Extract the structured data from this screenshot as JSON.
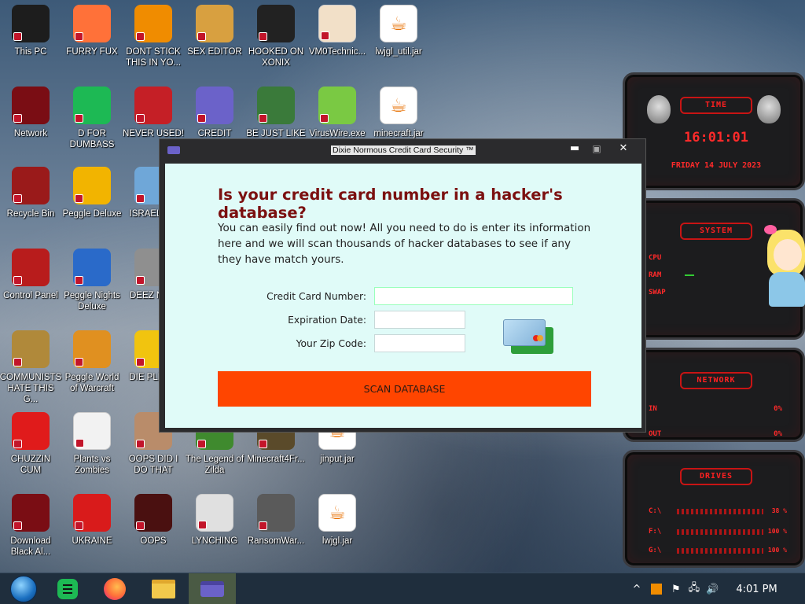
{
  "desktop": {
    "icons": [
      {
        "label": "This PC",
        "icon": "computer-icon",
        "color": "#1d1d1d"
      },
      {
        "label": "FURRY FUX",
        "icon": "firefox-icon",
        "color": "#ff7139"
      },
      {
        "label": "DONT STICK THIS IN YO...",
        "icon": "vlc-cone-icon",
        "color": "#f08c00"
      },
      {
        "label": "SEX EDITOR",
        "icon": "hxd-editor-icon",
        "color": "#d8a040"
      },
      {
        "label": "HOOKED ON XONIX",
        "icon": "xonix-game-icon",
        "color": "#222222"
      },
      {
        "label": "VM0Technic...",
        "icon": "doctor-icon",
        "color": "#f2e0c8"
      },
      {
        "label": "lwjgl_util.jar",
        "icon": "java-icon",
        "color": "#ffffff"
      },
      {
        "label": "Network",
        "icon": "network-alien-icon",
        "color": "#7a0d14"
      },
      {
        "label": "D FOR DUMBASS",
        "icon": "chat-icon",
        "color": "#1db954"
      },
      {
        "label": "NEVER USED!",
        "icon": "devcpp-icon",
        "color": "#c51f26"
      },
      {
        "label": "CREDIT CARD CHECKER",
        "icon": "credit-card-icon",
        "color": "#6b62c9"
      },
      {
        "label": "BE JUST LIKE THE DUDE!",
        "icon": "elf-icon",
        "color": "#3a7a3a"
      },
      {
        "label": "VirusWire.exe",
        "icon": "lime-icon",
        "color": "#7ac943"
      },
      {
        "label": "minecraft.jar",
        "icon": "java-icon",
        "color": "#ffffff"
      },
      {
        "label": "Recycle Bin",
        "icon": "recycle-bin-icon",
        "color": "#9a1a1a"
      },
      {
        "label": "Peggle Deluxe",
        "icon": "peggle-icon",
        "color": "#f2b400"
      },
      {
        "label": "ISRAEL S...",
        "icon": "tool-icon",
        "color": "#6fa7d8"
      },
      {
        "label": "Control Panel",
        "icon": "control-panel-icon",
        "color": "#b81c1c"
      },
      {
        "label": "Peggle Nights Deluxe",
        "icon": "peggle-icon",
        "color": "#2a6ac9"
      },
      {
        "label": "DEEZ NU...",
        "icon": "stack-icon",
        "color": "#8f8f8f"
      },
      {
        "label": "COMMUNISTS HATE THIS G...",
        "icon": "money-bag-icon",
        "color": "#b0893a"
      },
      {
        "label": "Peggle World of Warcraft",
        "icon": "peggle-icon",
        "color": "#e09020"
      },
      {
        "label": "DIE PLEA...",
        "icon": "d-logo-icon",
        "color": "#f1c40f"
      },
      {
        "label": "CHUZZIN CUM",
        "icon": "chuzzle-icon",
        "color": "#e01b1b"
      },
      {
        "label": "Plants vs Zombies",
        "icon": "flower-icon",
        "color": "#f2f2f2"
      },
      {
        "label": "OOPS DID I DO THAT",
        "icon": "portrait-icon",
        "color": "#b98c6a"
      },
      {
        "label": "The Legend of Zilda",
        "icon": "zelda-icon",
        "color": "#3f8a2e"
      },
      {
        "label": "Minecraft4Fr...",
        "icon": "minecraft-icon",
        "color": "#5a4a2a"
      },
      {
        "label": "jinput.jar",
        "icon": "java-icon",
        "color": "#ffffff"
      },
      {
        "label": "Download Black Al...",
        "icon": "alien-icon",
        "color": "#7a0d14"
      },
      {
        "label": "UKRAINE",
        "icon": "radiation-icon",
        "color": "#d91b1b"
      },
      {
        "label": "OOPS",
        "icon": "app-icon",
        "color": "#4a1010"
      },
      {
        "label": "LYNCHING",
        "icon": "rope-icon",
        "color": "#e0e0e0"
      },
      {
        "label": "RansomWar...",
        "icon": "skull-icon",
        "color": "#5a5a5a"
      },
      {
        "label": "lwjgl.jar",
        "icon": "java-icon",
        "color": "#ffffff"
      }
    ]
  },
  "widget": {
    "time_title": "TIME",
    "time": "16:01:01",
    "date": "FRIDAY 14 JULY 2023",
    "system_title": "SYSTEM",
    "cpu_label": "CPU",
    "ram_label": "RAM",
    "swap_label": "SWAP",
    "network_title": "NETWORK",
    "in_label": "IN",
    "out_label": "OUT",
    "in_value": "0%",
    "out_value": "0%",
    "drives_title": "DRIVES",
    "drives": [
      {
        "label": "C:\\",
        "value": "38 %"
      },
      {
        "label": "F:\\",
        "value": "100 %"
      },
      {
        "label": "G:\\",
        "value": "100 %"
      }
    ]
  },
  "window": {
    "title": "Dixie Normous Credit Card Security ™",
    "minimize": "▬",
    "maximize": "▣",
    "close": "✕",
    "heading": "Is your credit card number in a hacker's database?",
    "description": "You can easily find out now! All you need to do is enter its information here and we will scan thousands of hacker databases to see if any they have match yours.",
    "card_number_label": "Credit Card Number:",
    "card_number_value": "",
    "expiration_label": "Expiration Date:",
    "expiration_value": "",
    "zip_label": "Your Zip Code:",
    "zip_value": "",
    "scan_button": "SCAN DATABASE",
    "accent_color": "#ff4500",
    "heading_color": "#7b1010"
  },
  "taskbar": {
    "items": [
      "start-orb-icon",
      "chat-icon",
      "firefox-icon",
      "file-explorer-icon",
      "credit-card-icon"
    ],
    "clock": "4:01 PM"
  }
}
